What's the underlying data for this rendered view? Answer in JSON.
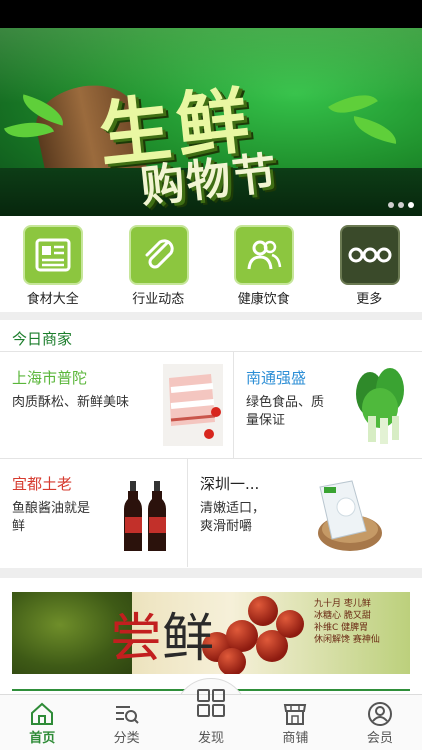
{
  "banner": {
    "headline": "生鲜",
    "subline": "购物节",
    "slides": 3,
    "active_slide": 3
  },
  "categories": [
    {
      "label": "食材大全",
      "icon": "newspaper-icon"
    },
    {
      "label": "行业动态",
      "icon": "paperclip-icon"
    },
    {
      "label": "健康饮食",
      "icon": "people-icon"
    },
    {
      "label": "更多",
      "icon": "more-dots-icon"
    }
  ],
  "merchants": {
    "title": "今日商家",
    "items": [
      {
        "name": "上海市普陀",
        "desc": "肉质酥松、新鲜美味",
        "color": "#5ab63a",
        "image": "pork-icon"
      },
      {
        "name": "南通强盛",
        "desc_line1": "绿色食品、质",
        "desc_line2": "量保证",
        "color": "#2e8fd6",
        "image": "greens-icon"
      },
      {
        "name": "宜都土老",
        "desc_line1": "鱼酿酱油就是",
        "desc_line2": "鲜",
        "color": "#d63a2e",
        "image": "soy-sauce-icon"
      },
      {
        "name": "深圳一...",
        "desc_line1": "清嫩适口，",
        "desc_line2": "爽滑耐嚼",
        "color": "#222222",
        "image": "noodles-icon"
      }
    ]
  },
  "promo": {
    "char1": "尝",
    "char2": "鲜",
    "poem_line1": "九十月 枣儿鲜",
    "poem_line2": "冰糖心 脆又甜",
    "poem_line3": "补维C 健脾胃",
    "poem_line4": "休闲解馋 赛神仙"
  },
  "tabs": [
    {
      "label": "首页",
      "icon": "home-icon",
      "active": true
    },
    {
      "label": "分类",
      "icon": "category-search-icon",
      "active": false
    },
    {
      "label": "发现",
      "icon": "grid-icon",
      "active": false
    },
    {
      "label": "商铺",
      "icon": "shop-icon",
      "active": false
    },
    {
      "label": "会员",
      "icon": "member-icon",
      "active": false
    }
  ],
  "colors": {
    "accent": "#2e8b37",
    "category_bg": "#8cc63f"
  }
}
